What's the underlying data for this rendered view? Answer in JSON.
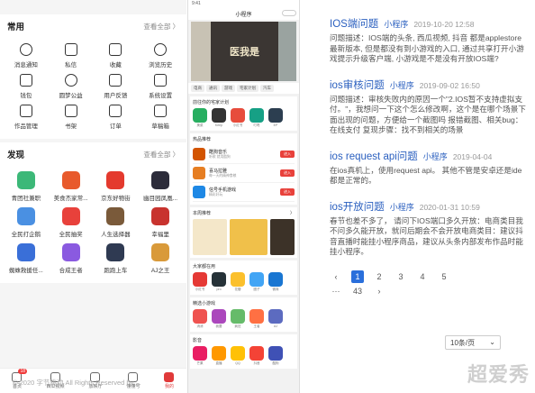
{
  "left": {
    "common": {
      "title": "常用",
      "more": "查看全部 〉",
      "items": [
        {
          "label": "消息通知",
          "icon": "bell-icon"
        },
        {
          "label": "私信",
          "icon": "message-icon"
        },
        {
          "label": "收藏",
          "icon": "star-icon"
        },
        {
          "label": "浏览历史",
          "icon": "clock-icon"
        },
        {
          "label": "钱包",
          "icon": "wallet-icon"
        },
        {
          "label": "圆梦公益",
          "icon": "charity-icon"
        },
        {
          "label": "用户反馈",
          "icon": "edit-icon"
        },
        {
          "label": "系统设置",
          "icon": "gear-icon"
        },
        {
          "label": "作品管理",
          "icon": "works-icon"
        },
        {
          "label": "书架",
          "icon": "bookshelf-icon"
        },
        {
          "label": "订单",
          "icon": "order-icon"
        },
        {
          "label": "草稿箱",
          "icon": "draft-icon"
        }
      ]
    },
    "discover": {
      "title": "发现",
      "more": "查看全部 〉",
      "items": [
        {
          "label": "青团社兼职",
          "color": "#3cb878",
          "icon": "qingtuan-app-icon"
        },
        {
          "label": "美食杰家常...",
          "color": "#e85a2c",
          "icon": "meishijie-app-icon"
        },
        {
          "label": "京东好物街",
          "color": "#e43a2e",
          "icon": "jd-app-icon"
        },
        {
          "label": "幽目园凤凰...",
          "color": "#2c2c3a",
          "icon": "phoenix-app-icon"
        },
        {
          "label": "全民打企鹅",
          "color": "#4a90e2",
          "icon": "penguin-app-icon"
        },
        {
          "label": "全民抽奖",
          "color": "#e8413b",
          "icon": "lottery-app-icon"
        },
        {
          "label": "人生选择器",
          "color": "#7a5a3a",
          "icon": "life-app-icon"
        },
        {
          "label": "幸福里",
          "color": "#c8332e",
          "icon": "xingfuli-app-icon"
        },
        {
          "label": "蜘蛛救援任...",
          "color": "#3a6fd8",
          "icon": "spider-app-icon"
        },
        {
          "label": "合成王者",
          "color": "#8a5ae0",
          "icon": "hecheng-app-icon"
        },
        {
          "label": "跑跑上车",
          "color": "#2f3a52",
          "icon": "paopao-app-icon"
        },
        {
          "label": "AJ之王",
          "color": "#d99a3a",
          "icon": "aj-app-icon"
        }
      ]
    },
    "nav": [
      {
        "label": "首页",
        "badge": "18"
      },
      {
        "label": "西瓜视频"
      },
      {
        "label": "放映厅"
      },
      {
        "label": "懂懂号"
      },
      {
        "label": "我的",
        "active": true
      }
    ]
  },
  "mid": {
    "status": "9:41",
    "title": "小程序",
    "banner_text": "医我是",
    "chips": [
      "电商",
      "通讯",
      "游戏",
      "宅家计划",
      "汽车"
    ],
    "card1": {
      "title": "前往你的宅家计划",
      "apps": [
        {
          "c": "#27ae60",
          "l": "美菜"
        },
        {
          "c": "#333",
          "l": "Keep"
        },
        {
          "c": "#e74c3c",
          "l": "小红书"
        },
        {
          "c": "#16a085",
          "l": "叮咚"
        },
        {
          "c": "#2c3e50",
          "l": "EP"
        }
      ]
    },
    "card2": {
      "title": "热品推荐",
      "items": [
        {
          "c": "#d35400",
          "n": "酷狗音乐",
          "s": "听歌 就用酷狗",
          "b": "进入"
        },
        {
          "c": "#e67e22",
          "n": "喜马拉雅",
          "s": "每一天的精神食粮",
          "b": "进入"
        },
        {
          "c": "#1e88e5",
          "n": "信号手机游戏",
          "s": "精彩好玩",
          "b": "进入"
        }
      ]
    },
    "card3": {
      "title": "本周推荐",
      "more": "〉"
    },
    "card4": {
      "title": "大家都在用",
      "apps": [
        {
          "c": "#e53935",
          "l": "小红书"
        },
        {
          "c": "#263238",
          "l": "pro"
        },
        {
          "c": "#fbc02d",
          "l": "花瓣"
        },
        {
          "c": "#42a5f5",
          "l": "圈子"
        },
        {
          "c": "#1976d2",
          "l": "微商"
        }
      ]
    },
    "card5": {
      "title": "精选小游戏",
      "apps": [
        {
          "c": "#ef5350",
          "l": "消消"
        },
        {
          "c": "#ab47bc",
          "l": "我要"
        },
        {
          "c": "#66bb6a",
          "l": "疯狂"
        },
        {
          "c": "#ff7043",
          "l": "王者"
        },
        {
          "c": "#5c6bc0",
          "l": "AJ"
        }
      ]
    },
    "card6": {
      "title": "影音",
      "apps": [
        {
          "c": "#e91e63",
          "l": "芒果"
        },
        {
          "c": "#ff9800",
          "l": "直播"
        },
        {
          "c": "#ffc107",
          "l": "QQ"
        },
        {
          "c": "#f44336",
          "l": "抖音"
        },
        {
          "c": "#3f51b5",
          "l": "酷狗"
        }
      ]
    }
  },
  "right": {
    "questions": [
      {
        "title": "IOS端问题",
        "tag": "小程序",
        "date": "2019-10-20 12:58",
        "body": "问题描述：IOS端的头条, 西瓜视频, 抖音 都是applestore最新版本, 但是都没有到小游戏的入口, 通过共享打开小游戏提示升级客户端, 小游戏是不是没有开放IOS端?"
      },
      {
        "title": "ios审核问题",
        "tag": "小程序",
        "date": "2019-09-02 16:50",
        "body": "问题描述：审核失败内的原因一个\"2.IOS暂不支持虚拟支付。\"，我想问一下这个怎么修改啊，这个是在哪个场景下面出现的问题，方便给一个截图吗 报错截图、相关bug：在线支付 复现步骤：找不到相关的场景"
      },
      {
        "title": "ios request api问题",
        "tag": "小程序",
        "date": "2019-04-04",
        "body": "在ios真机上，使用request api。 其他不管是安卓还是ide都是正常的。"
      },
      {
        "title": "ios开放问题",
        "tag": "小程序",
        "date": "2020-01-31 10:59",
        "body": "春节也差不多了， 请问下IOS端口多久开放：电商类目我不问多久能开放，就问后期会不会开放电商类目：建议抖音直播时能挂小程序商品，建议从头条内部发布作品时能挂小程序。"
      }
    ],
    "pager": {
      "prev": "‹",
      "pages": [
        "1",
        "2",
        "3",
        "4",
        "5"
      ],
      "current": "1",
      "more": "···",
      "last": "43",
      "next": "›",
      "size": "10条/页"
    },
    "footer": "© 2020 字节跳动 All Rights Reserved by ..."
  },
  "watermark": "超爱秀"
}
